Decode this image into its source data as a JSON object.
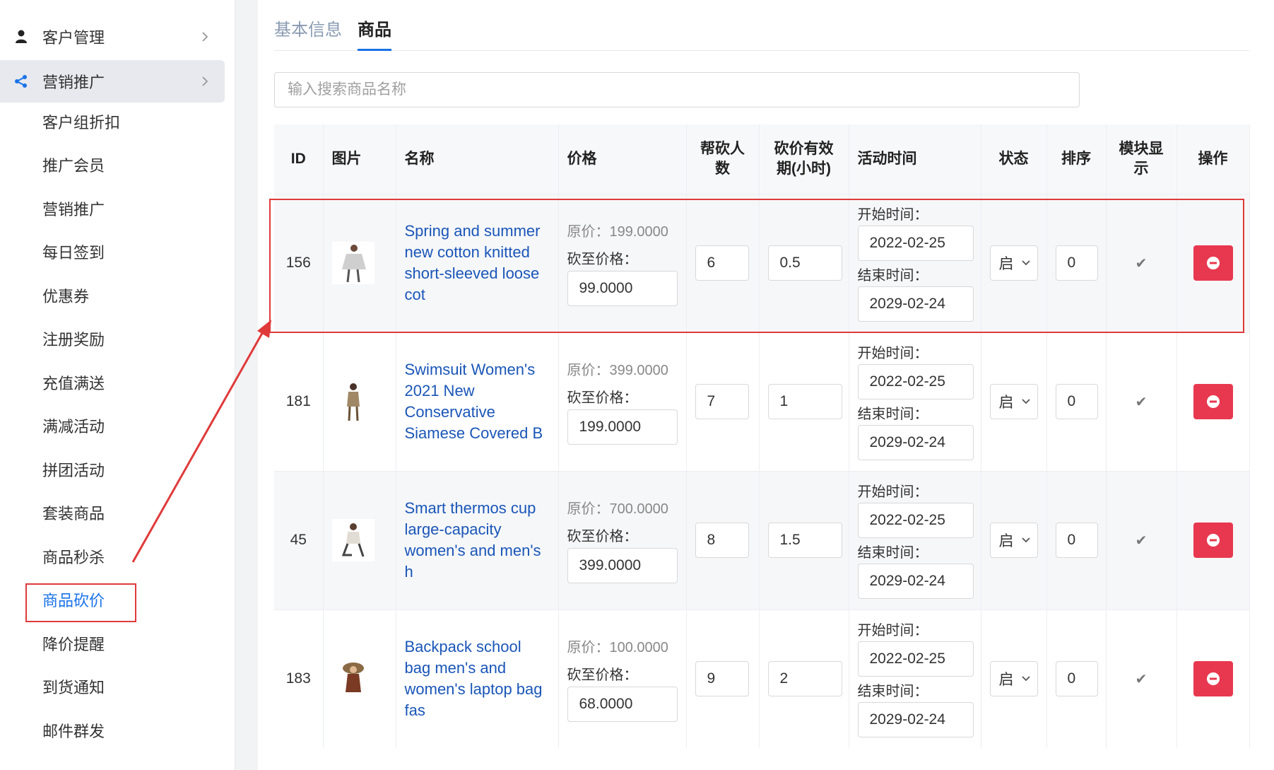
{
  "sidebar": {
    "top_items": [
      {
        "label": "客户管理",
        "icon": "user-icon"
      },
      {
        "label": "营销推广",
        "icon": "share-icon"
      }
    ],
    "sub_items": [
      "客户组折扣",
      "推广会员",
      "营销推广",
      "每日签到",
      "优惠券",
      "注册奖励",
      "充值满送",
      "满减活动",
      "拼团活动",
      "套装商品",
      "商品秒杀",
      "商品砍价",
      "降价提醒",
      "到货通知",
      "邮件群发"
    ],
    "current_item": "商品砍价"
  },
  "tabs": [
    "基本信息",
    "商品"
  ],
  "active_tab": "商品",
  "search": {
    "placeholder": "输入搜索商品名称"
  },
  "table": {
    "headers": {
      "id": "ID",
      "image": "图片",
      "name": "名称",
      "price": "价格",
      "helpers": "帮砍人数",
      "validity": "砍价有效期(小时)",
      "activity_time": "活动时间",
      "status": "状态",
      "sort": "排序",
      "module_display": "模块显示",
      "actions": "操作"
    },
    "labels": {
      "orig_prefix": "原价：",
      "cut_price": "砍至价格：",
      "start_time": "开始时间：",
      "end_time": "结束时间："
    },
    "rows": [
      {
        "id": "156",
        "name": "Spring and summer new cotton knitted short-sleeved loose cot",
        "orig_price": "199.0000",
        "cut_price": "99.0000",
        "helpers": "6",
        "validity": "0.5",
        "start": "2022-02-25",
        "end": "2029-02-24",
        "status": "启",
        "sort": "0",
        "display": true
      },
      {
        "id": "181",
        "name": "Swimsuit Women's 2021 New Conservative Siamese Covered B",
        "orig_price": "399.0000",
        "cut_price": "199.0000",
        "helpers": "7",
        "validity": "1",
        "start": "2022-02-25",
        "end": "2029-02-24",
        "status": "启",
        "sort": "0",
        "display": true
      },
      {
        "id": "45",
        "name": "Smart thermos cup large-capacity women's and men's h",
        "orig_price": "700.0000",
        "cut_price": "399.0000",
        "helpers": "8",
        "validity": "1.5",
        "start": "2022-02-25",
        "end": "2029-02-24",
        "status": "启",
        "sort": "0",
        "display": true
      },
      {
        "id": "183",
        "name": "Backpack school bag men's and women's laptop bag fas",
        "orig_price": "100.0000",
        "cut_price": "68.0000",
        "helpers": "9",
        "validity": "2",
        "start": "2022-02-25",
        "end": "2029-02-24",
        "status": "启",
        "sort": "0",
        "display": true
      }
    ]
  },
  "colors": {
    "accent": "#1a73e8",
    "link": "#1a56b8",
    "danger": "#e8384f",
    "annotation": "#e03a3a"
  }
}
